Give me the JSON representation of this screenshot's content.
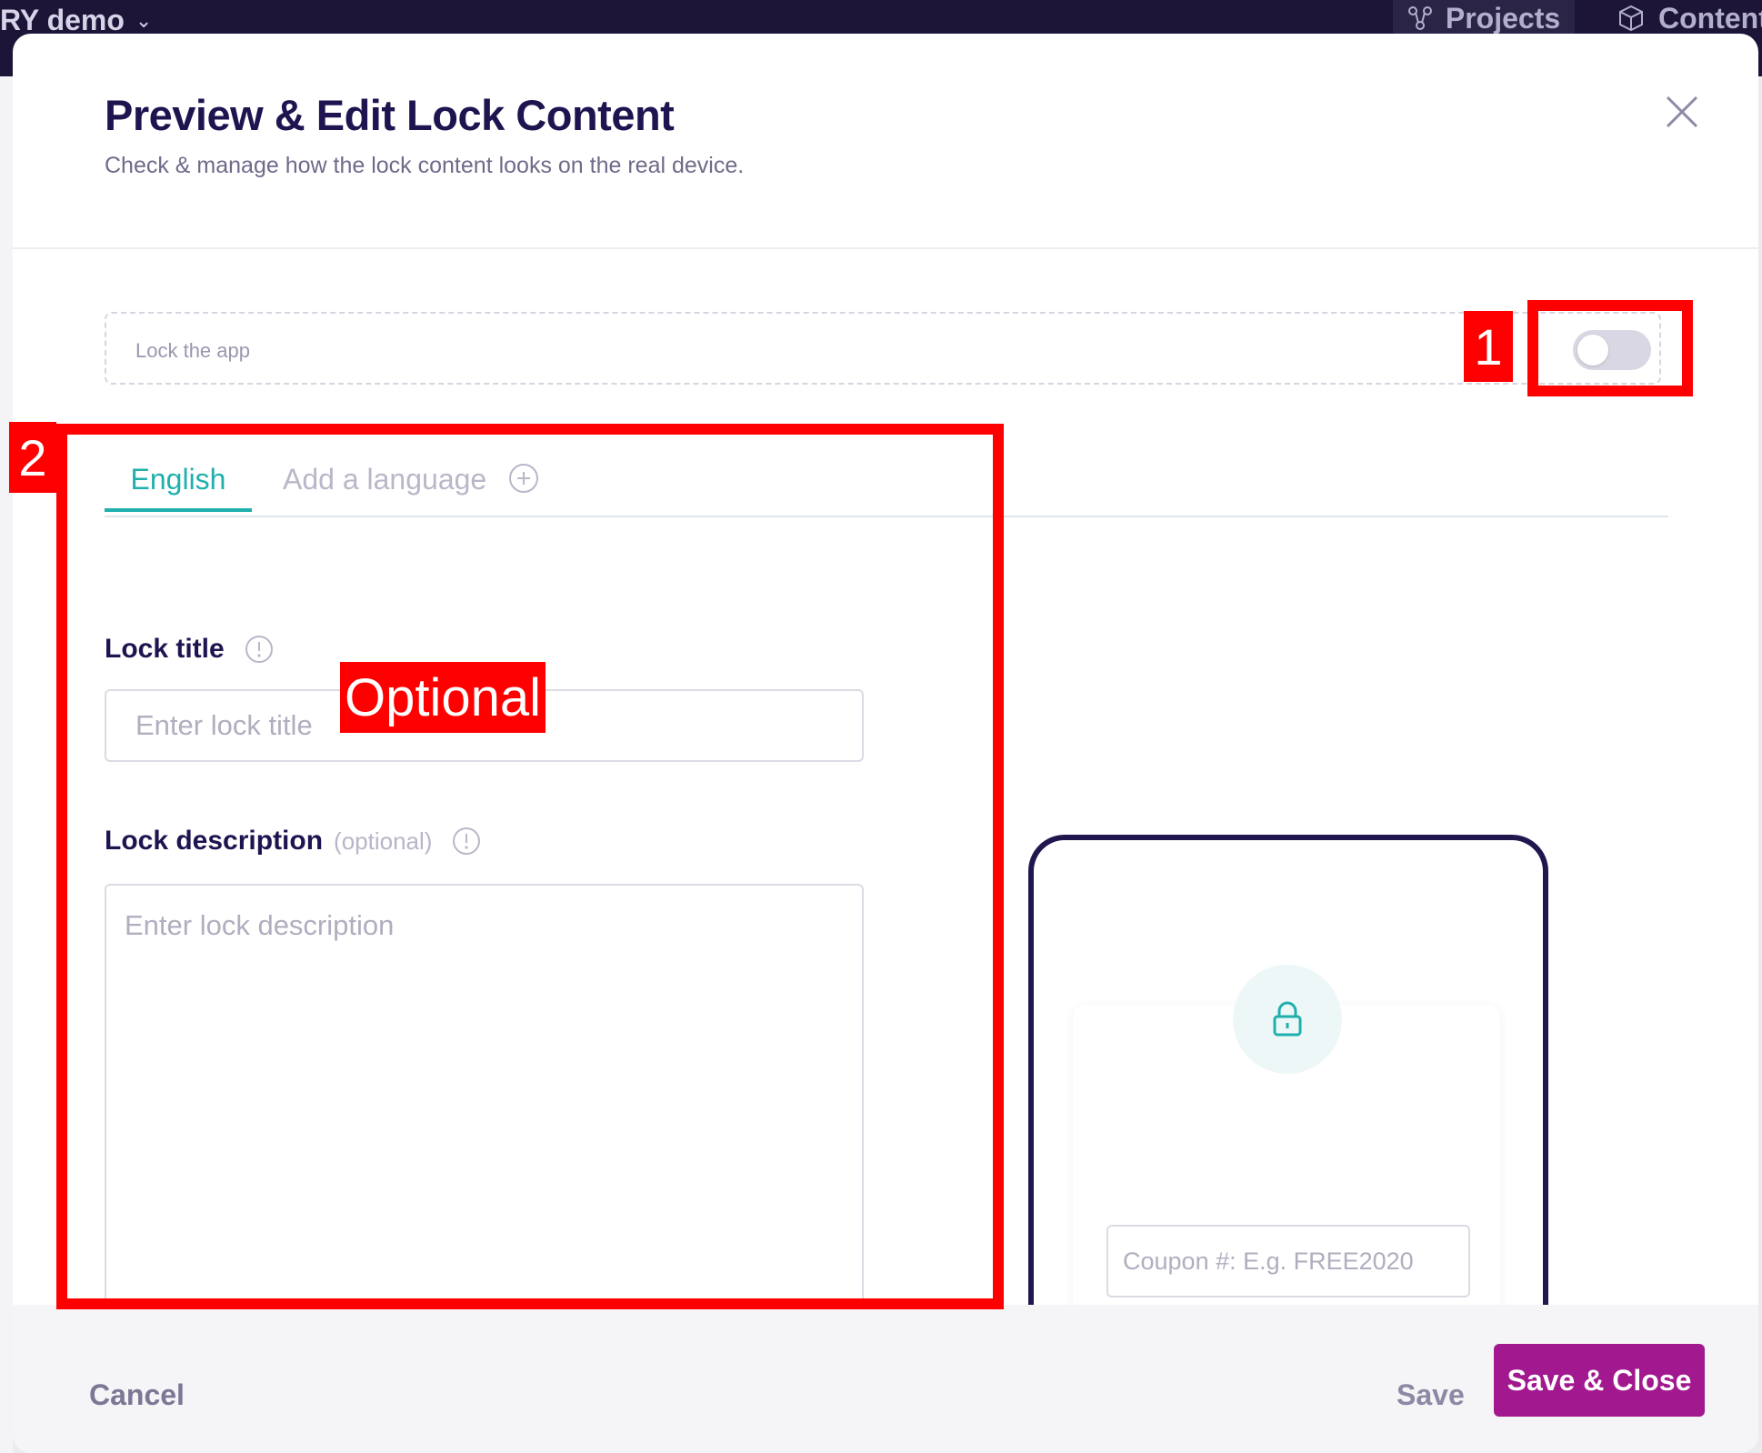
{
  "topbar": {
    "brand": "RY demo",
    "nav": {
      "projects": "Projects",
      "content": "Content"
    }
  },
  "modal": {
    "title": "Preview & Edit Lock Content",
    "subtitle": "Check & manage how the lock content looks on the real device.",
    "lock_app": {
      "label": "Lock the app",
      "enabled": false
    },
    "tabs": [
      {
        "label": "English",
        "active": true
      },
      {
        "label": "Add a language",
        "active": false
      }
    ],
    "lock_title": {
      "label": "Lock title",
      "placeholder": "Enter lock title",
      "value": ""
    },
    "lock_description": {
      "label": "Lock description",
      "optional_tag": "(optional)",
      "placeholder": "Enter lock description",
      "value": ""
    },
    "preview": {
      "coupon_placeholder": "Coupon #: E.g. FREE2020"
    },
    "footer": {
      "cancel": "Cancel",
      "save": "Save",
      "save_close": "Save & Close"
    }
  },
  "annotations": {
    "badge_1": "1",
    "badge_2": "2",
    "optional": "Optional"
  },
  "colors": {
    "accent_teal": "#1fb0ad",
    "primary_dark": "#1f1450",
    "save_close_bg": "#a2188e",
    "annotation_red": "#ff0000"
  }
}
